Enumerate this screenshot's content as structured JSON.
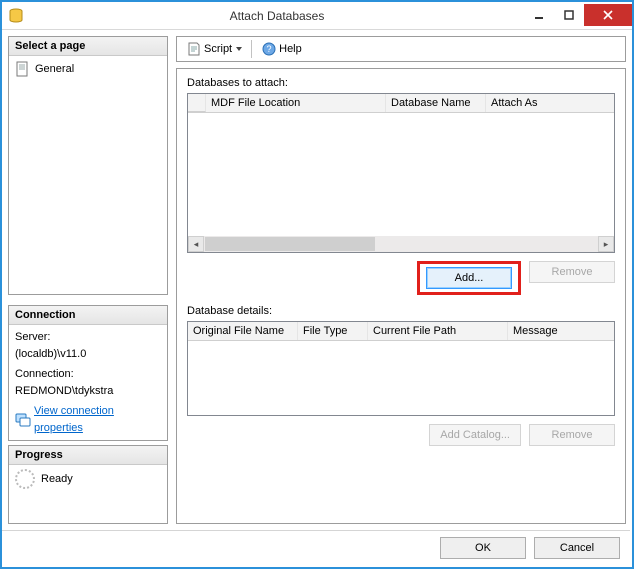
{
  "window": {
    "title": "Attach Databases"
  },
  "sidebar": {
    "select_a_page": "Select a page",
    "pages": [
      "General"
    ],
    "connection_header": "Connection",
    "server_label": "Server:",
    "server_value": "(localdb)\\v11.0",
    "connection_label": "Connection:",
    "connection_value": "REDMOND\\tdykstra",
    "view_props": "View connection properties",
    "progress_header": "Progress",
    "progress_status": "Ready"
  },
  "toolbar": {
    "script": "Script",
    "help": "Help"
  },
  "attach_grid": {
    "label": "Databases to attach:",
    "columns": [
      "MDF File Location",
      "Database Name",
      "Attach As"
    ],
    "rows": []
  },
  "attach_buttons": {
    "add": "Add...",
    "remove": "Remove"
  },
  "details_grid": {
    "label": "Database details:",
    "columns": [
      "Original File Name",
      "File Type",
      "Current File Path",
      "Message"
    ],
    "rows": []
  },
  "details_buttons": {
    "add_catalog": "Add Catalog...",
    "remove": "Remove"
  },
  "footer": {
    "ok": "OK",
    "cancel": "Cancel"
  }
}
